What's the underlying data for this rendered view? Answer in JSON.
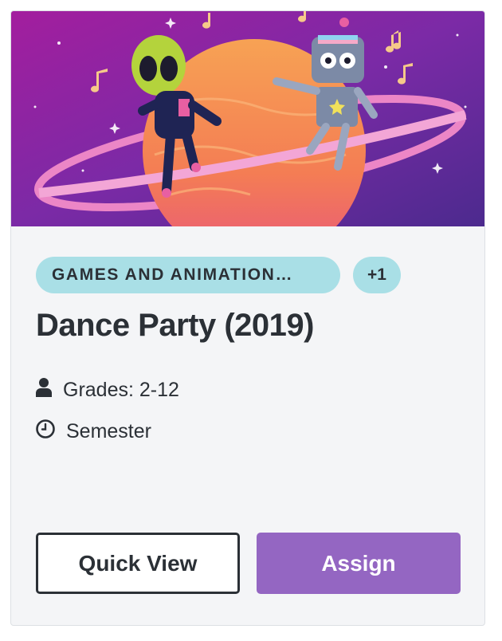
{
  "card": {
    "image_alt": "Dance Party (2019)",
    "tags": [
      "GAMES AND ANIMATION…",
      "+1"
    ],
    "title": "Dance Party (2019)",
    "grades": "Grades: 2-12",
    "duration": "Semester",
    "quick_view_label": "Quick View",
    "assign_label": "Assign"
  },
  "icons": {
    "grades": "person-icon",
    "duration": "clock-icon"
  },
  "colors": {
    "tag_bg": "#a9dfe6",
    "text": "#2b3036",
    "assign_bg": "#9466c2",
    "hero_purple": "#7a2aa8",
    "planet_orange": "#f58a4e"
  }
}
